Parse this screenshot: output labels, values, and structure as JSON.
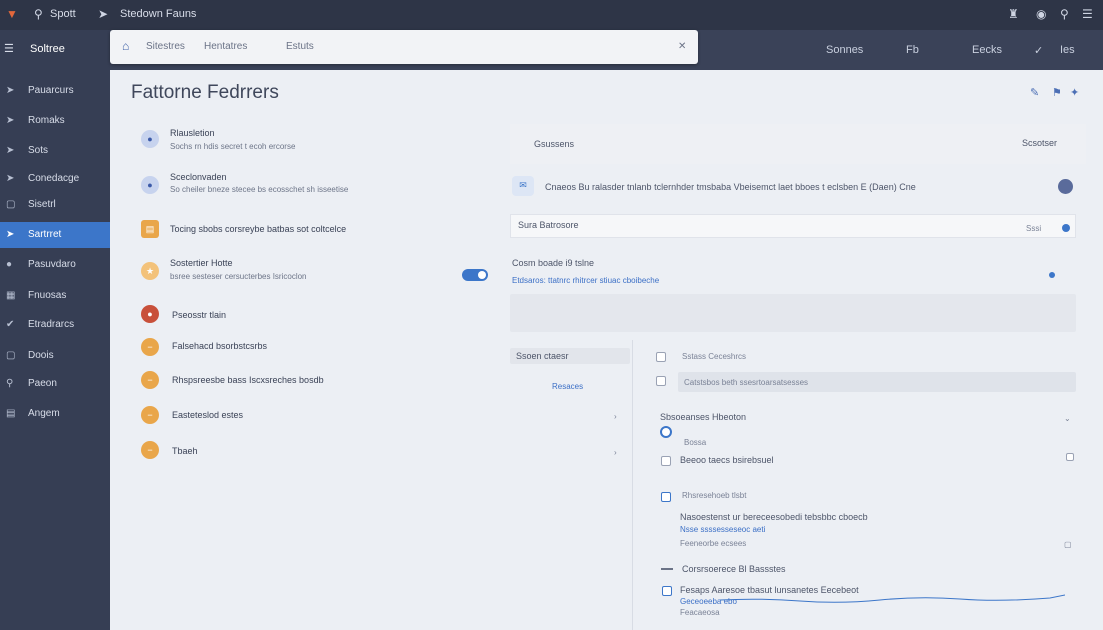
{
  "topbar": {
    "app_name": "Spott",
    "window_title": "Stedown Fauns"
  },
  "search": {
    "icon_label": "Sitestres",
    "crumb1": "Hentatres",
    "crumb2": "Estuts"
  },
  "header_links": [
    "Sonnes",
    "Fb",
    "Eecks",
    "Ies"
  ],
  "sidebar": {
    "title": "Soltree",
    "items": [
      {
        "label": "Pauarcurs",
        "icon": "arrow-icon"
      },
      {
        "label": "Romaks",
        "icon": "arrow-icon"
      },
      {
        "label": "Sots",
        "icon": "arrow-icon"
      },
      {
        "label": "Conedacge",
        "icon": "arrow-icon"
      },
      {
        "label": "Sisetrl",
        "icon": "box-icon"
      },
      {
        "label": "Sartrret",
        "icon": "arrow-icon"
      },
      {
        "label": "Pasuvdaro",
        "icon": "pin-icon"
      },
      {
        "label": "Fnuosas",
        "icon": "grid-icon"
      },
      {
        "label": "Etradrarcs",
        "icon": "tool-icon"
      },
      {
        "label": "Doois",
        "icon": "box-icon"
      },
      {
        "label": "Paeon",
        "icon": "search-icon"
      },
      {
        "label": "Angem",
        "icon": "folder-icon"
      }
    ]
  },
  "main": {
    "title": "Fattorne Fedrrers",
    "left_list": [
      {
        "title": "Rlausletion",
        "desc": "Sochs rn hdis secret t ecoh ercorse"
      },
      {
        "title": "Sceclonvaden",
        "desc": "So cheiler bneze stecee bs ecosschet sh isseetise"
      },
      {
        "title": "Tocing sbobs corsreybe batbas sot coltcelce",
        "desc": ""
      },
      {
        "title": "Sostertier Hotte",
        "desc": "bsree sesteser cersucterbes Isricoclon"
      },
      {
        "title": "Pseosstr tlain",
        "desc": ""
      },
      {
        "title": "Falsehacd bsorbstcsrbs",
        "desc": ""
      },
      {
        "title": "Rhspsreesbe bass Iscxsreches bosdb",
        "desc": ""
      },
      {
        "title": "Easteteslod estes",
        "desc": ""
      },
      {
        "title": "Tbaeh",
        "desc": ""
      }
    ],
    "right": {
      "tab_left": "Gsussens",
      "tab_right": "Scsotser",
      "info_text": "Cnaeos Bu ralasder tnlanb tclernhder tmsbaba Vbeisemct laet bboes t eclsben E (Daen) Cne",
      "field1": "Sura Batrosore",
      "field1_btn": "Sssi",
      "sub_title": "Cosm boade i9 tslne",
      "sub_desc": "Etdsaros: ttatnrc rhitrcer stiuac cboibeche",
      "left_pane_title": "Ssoen ctaesr",
      "left_pane_link": "Resaces",
      "rp_header": "Sstass Ceceshrcs",
      "rp_field": "Catstsbos beth ssesrtoarsatsesses",
      "rp_radio_title": "Sbsoeanses Hbeoton",
      "rp_radio_opt": "Bossa",
      "rp_check1": "Beeoo  taecs bsirebsuel",
      "rp_group2_title": "Rhsresehoeb tlsbt",
      "rp_group2_line1": "Nasoestenst ur bereceesobedi tebsbbc cboecb",
      "rp_group2_line2": "Nsse ssssesseseoc aeti",
      "rp_group2_line3": "Feeneorbe ecsees",
      "rp_group3_title": "Corsrsoerece Bl Bassstes",
      "rp_group3_line1": "Fesaps  Aaresoe tbasut lunsanetes Eecebeot",
      "rp_group3_line2": "Geceoeeba ebo",
      "rp_group3_line3": "Feacaeosa"
    }
  },
  "colors": {
    "accent": "#3c76c9",
    "sidebar": "#363e54",
    "topbar": "#2e3547",
    "orange": "#e9a64a"
  }
}
